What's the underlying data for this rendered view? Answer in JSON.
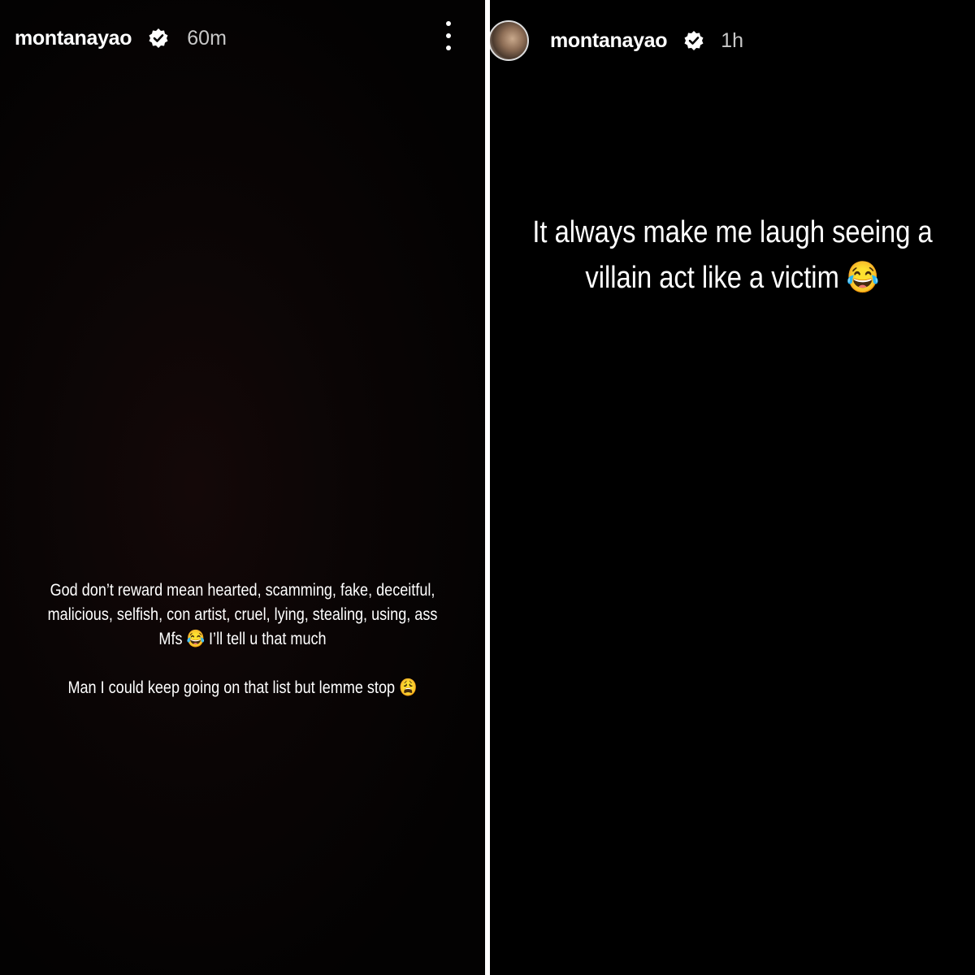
{
  "stories": [
    {
      "username": "montanayao",
      "verified": true,
      "timestamp": "60m",
      "menu_icon": "more-vertical-icon",
      "text_para1": "God don’t reward mean hearted, scamming, fake, deceitful, malicious, selfish, con artist, cruel, lying, stealing, using, ass Mfs 😂 I’ll tell u that much",
      "text_para2": "Man I could keep going on that list but lemme stop 😩"
    },
    {
      "username": "montanayao",
      "verified": true,
      "timestamp": "1h",
      "text": "It always make me laugh seeing a villain act like a victim 😂"
    }
  ],
  "colors": {
    "background": "#000000",
    "divider": "#ffffff",
    "text": "#ffffff",
    "timestamp": "#c8c8c8"
  }
}
